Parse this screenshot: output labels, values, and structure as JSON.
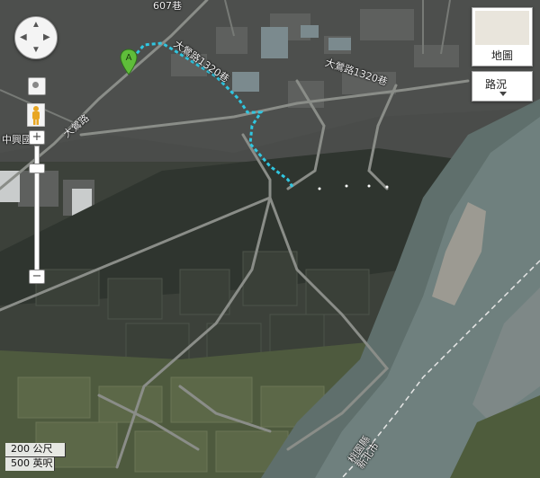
{
  "map": {
    "labels": {
      "road_top": "607巷",
      "road_1320_a": "大鶯路1320巷",
      "road_1320_b": "大鶯路1320巷",
      "road_main": "大鶯路",
      "school": "中興國",
      "boundary": "桃園縣\n新北市"
    },
    "marker_label": "A",
    "colors": {
      "route": "#30c6e0",
      "marker": "#5fbd3a"
    }
  },
  "controls": {
    "map_type": "地圖",
    "traffic": "路況",
    "zoom_in": "+",
    "zoom_out": "−",
    "pan_icons": [
      "pan-up-icon",
      "pan-down-icon",
      "pan-left-icon",
      "pan-right-icon"
    ]
  },
  "scale": {
    "metric": "200 公尺",
    "imperial": "500 英呎"
  }
}
